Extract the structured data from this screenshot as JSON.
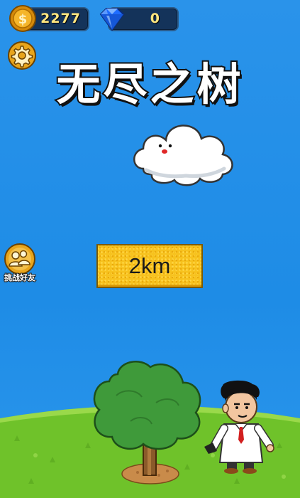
{
  "game": {
    "title": "无尽之树"
  },
  "currency": {
    "coins": "2277",
    "gems": "0"
  },
  "social": {
    "challenge_friends_label": "挑战好友"
  },
  "distance": {
    "label": "2km"
  },
  "colors": {
    "sky": "#1f8fe6",
    "button_yellow": "#f7c21e",
    "grass": "#7ccc2e",
    "tree_green": "#3f9a3a"
  },
  "icons": [
    "coin-icon",
    "diamond-icon",
    "gear-icon",
    "friends-icon",
    "cloud-face",
    "tree",
    "scientist-character"
  ]
}
